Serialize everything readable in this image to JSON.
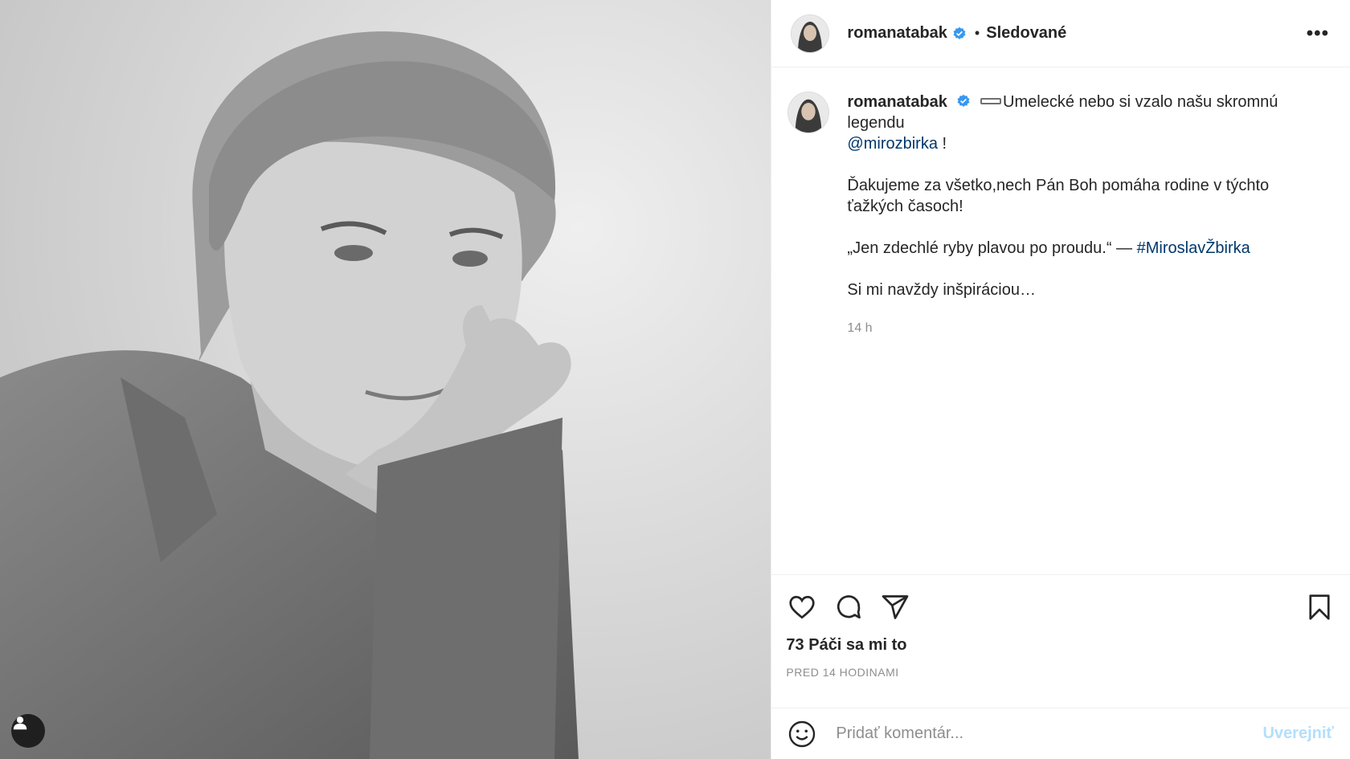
{
  "photo": {
    "alt": "black-and-white portrait",
    "tag_icon": "user-icon"
  },
  "header": {
    "username": "romanatabak",
    "verified_icon": "verified-badge-icon",
    "separator": "•",
    "follow_status": "Sledované",
    "more_icon": "more-options-icon",
    "more_label": "•••"
  },
  "caption": {
    "username": "romanatabak",
    "line1": "Umelecké nebo si vzalo našu skromnú legendu",
    "mention": "@mirozbirka",
    "mention_suffix": " !",
    "para2": "Ďakujeme za všetko,nech Pán Boh pomáha rodine v týchto ťažkých časoch!",
    "quote": "„Jen zdechlé ryby plavou po proudu.“ — ",
    "hashtag": "#MiroslavŽbirka",
    "para4": "Si mi navždy inšpiráciou…",
    "time": "14 h"
  },
  "actions": {
    "icons": [
      "heart-icon",
      "comment-icon",
      "share-icon",
      "bookmark-icon"
    ],
    "likes": "73 Páči sa mi to",
    "timestamp": "PRED 14 HODINAMI"
  },
  "comment_box": {
    "emoji_icon": "emoji-icon",
    "placeholder": "Pridať komentár...",
    "value": "",
    "post_label": "Uverejniť"
  },
  "colors": {
    "link": "#00376b",
    "verified": "#3897f0",
    "muted": "#8e8e8e",
    "post_disabled": "#b2dffc"
  }
}
